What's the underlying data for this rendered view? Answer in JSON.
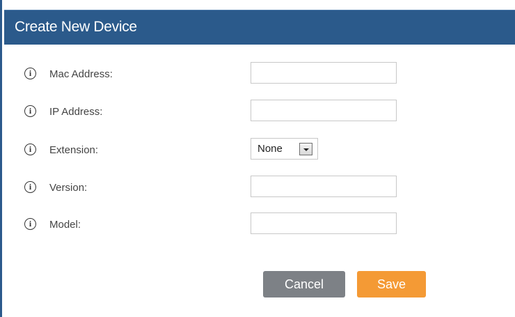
{
  "dialog": {
    "title": "Create New Device"
  },
  "form": {
    "fields": [
      {
        "label": "Mac Address:",
        "value": ""
      },
      {
        "label": "IP Address:",
        "value": ""
      },
      {
        "label": "Extension:",
        "selected": "None"
      },
      {
        "label": "Version:",
        "value": ""
      },
      {
        "label": "Model:",
        "value": ""
      }
    ]
  },
  "icons": {
    "info": "info-circle-icon",
    "info_glyph": "i",
    "dropdown": "chevron-down-icon"
  },
  "actions": {
    "cancel_label": "Cancel",
    "save_label": "Save"
  },
  "colors": {
    "header_bg": "#2b5a8b",
    "cancel_bg": "#7d8186",
    "save_bg": "#f49a35"
  }
}
